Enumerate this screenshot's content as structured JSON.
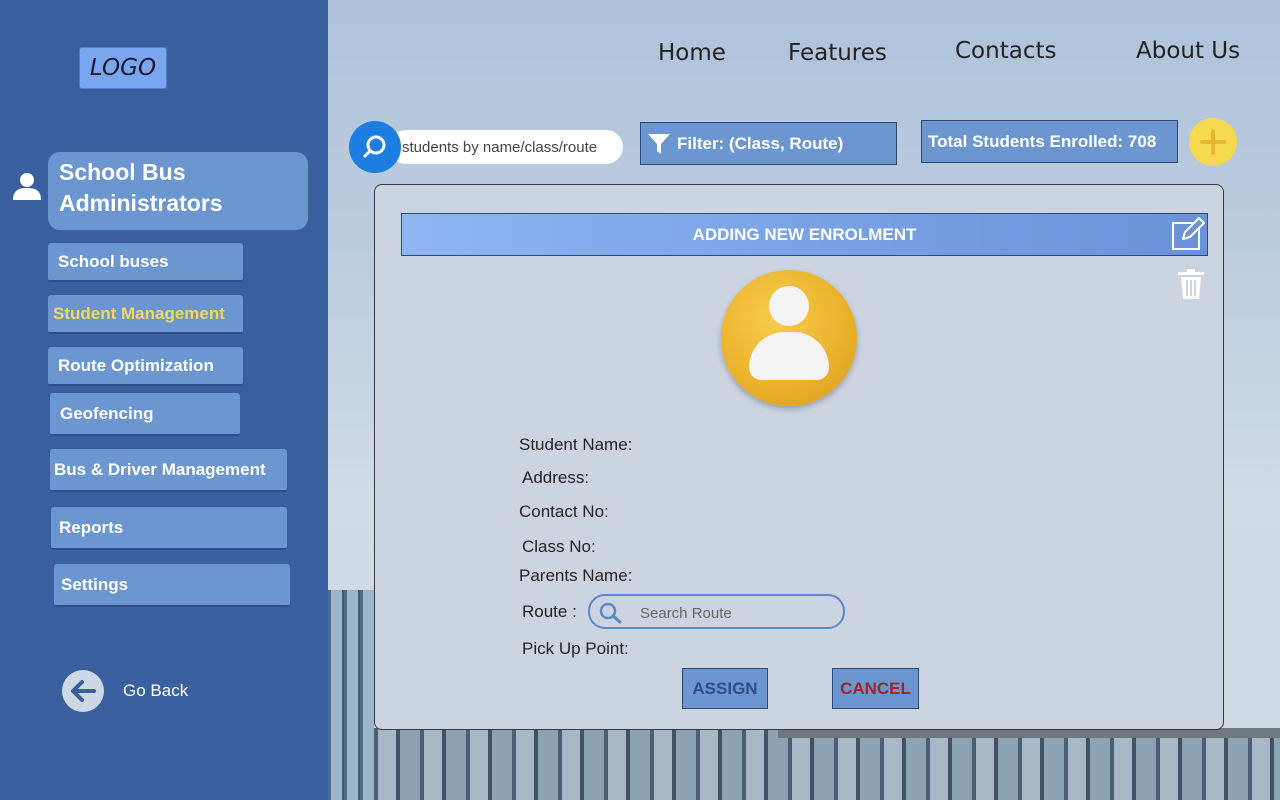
{
  "colors": {
    "sidebar_bg": "#3a5f9e",
    "nav_item_bg": "#6c96d0",
    "active_text": "#f2d85b",
    "search_accent": "#1c7ee0",
    "add_button": "#f5d94e",
    "cancel_text": "#a02424"
  },
  "sidebar": {
    "logo": "LOGO",
    "admin_title": "School Bus Administrators",
    "items": [
      {
        "label": "School buses",
        "active": false
      },
      {
        "label": "Student Management",
        "active": true
      },
      {
        "label": "Route Optimization",
        "active": false
      },
      {
        "label": "Geofencing",
        "active": false
      },
      {
        "label": "Bus & Driver Management",
        "active": false
      },
      {
        "label": "Reports",
        "active": false
      },
      {
        "label": "Settings",
        "active": false
      }
    ],
    "go_back": "Go Back",
    "icons": {
      "user": "user-icon",
      "back": "arrow-left-icon"
    }
  },
  "topnav": {
    "items": [
      "Home",
      "Features",
      "Contacts",
      "About Us"
    ]
  },
  "toolbar": {
    "search_placeholder": "students by name/class/route",
    "filter_label": "Filter: (Class, Route)",
    "total_label": "Total Students Enrolled: 708",
    "icons": {
      "search": "search-icon",
      "filter": "funnel-icon",
      "add": "plus-icon"
    }
  },
  "panel": {
    "title": "ADDING NEW ENROLMENT",
    "fields": {
      "student_name": "Student Name:",
      "address": "Address:",
      "contact_no": "Contact No:",
      "class_no": "Class No:",
      "parents_name": "Parents Name:",
      "route": "Route :",
      "pickup": "Pick Up Point:"
    },
    "route_placeholder": "Search Route",
    "assign_label": "ASSIGN",
    "cancel_label": "CANCEL",
    "icons": {
      "edit": "edit-icon",
      "delete": "trash-icon",
      "avatar": "user-avatar-icon"
    }
  }
}
